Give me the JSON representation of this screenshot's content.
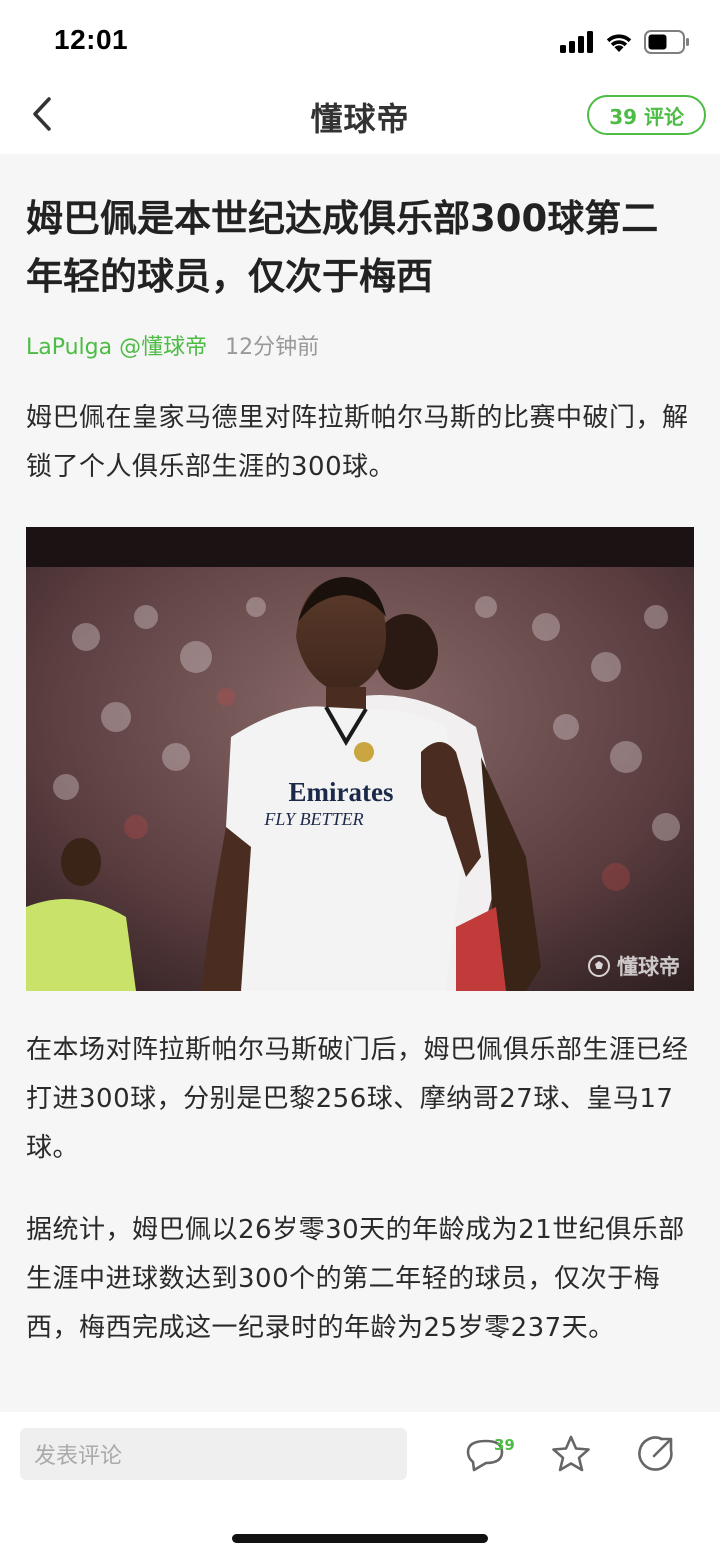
{
  "status": {
    "time": "12:01",
    "icons": [
      "cellular-signal-icon",
      "wifi-icon",
      "battery-icon"
    ]
  },
  "nav": {
    "back_icon": "chevron-left-icon",
    "title": "懂球帝",
    "comment_button": "39 评论"
  },
  "article": {
    "title": "姆巴佩是本世纪达成俱乐部300球第二年轻的球员，仅次于梅西",
    "author": "LaPulga @懂球帝",
    "time": "12分钟前",
    "paragraphs": [
      "姆巴佩在皇家马德里对阵拉斯帕尔马斯的比赛中破门，解锁了个人俱乐部生涯的300球。",
      "在本场对阵拉斯帕尔马斯破门后，姆巴佩俱乐部生涯已经打进300球，分别是巴黎256球、摩纳哥27球、皇马17球。",
      "据统计，姆巴佩以26岁零30天的年龄成为21世纪俱乐部生涯中进球数达到300个的第二年轻的球员，仅次于梅西，梅西完成这一纪录时的年龄为25岁零237天。"
    ],
    "photo": {
      "jersey_line1": "Emirates",
      "jersey_line2": "FLY BETTER",
      "watermark": "懂球帝"
    }
  },
  "bottom_bar": {
    "comment_placeholder": "发表评论",
    "comment_count": "39",
    "icons": [
      "comment-icon",
      "star-icon",
      "share-icon"
    ]
  },
  "colors": {
    "accent": "#4cbc44",
    "background": "#f6f6f6",
    "text": "#222222",
    "muted": "#999999"
  }
}
